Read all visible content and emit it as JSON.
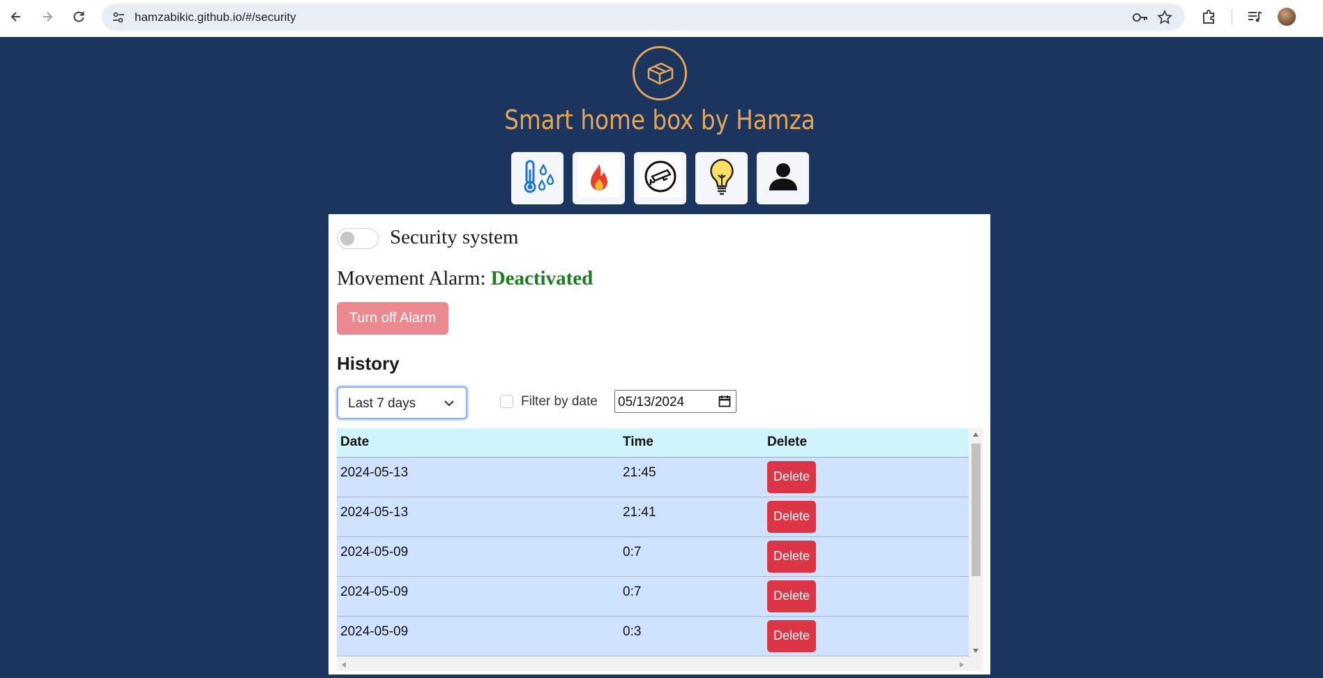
{
  "browser": {
    "url": "hamzabikic.github.io/#/security"
  },
  "header": {
    "title": "Smart home box by Hamza",
    "nav": [
      "temperature-humidity",
      "fire",
      "security-camera",
      "lighting",
      "user"
    ]
  },
  "security": {
    "toggle_label": "Security system",
    "toggle_on": false,
    "alarm_prefix": "Movement Alarm: ",
    "alarm_status": "Deactivated",
    "turn_off_label": "Turn off Alarm"
  },
  "history": {
    "title": "History",
    "range_value": "Last 7 days",
    "filter_label": "Filter by date",
    "filter_checked": false,
    "date_value": "05/13/2024",
    "columns": [
      "Date",
      "Time",
      "Delete"
    ],
    "rows": [
      {
        "date": "2024-05-13",
        "time": "21:45",
        "action": "Delete"
      },
      {
        "date": "2024-05-13",
        "time": "21:41",
        "action": "Delete"
      },
      {
        "date": "2024-05-09",
        "time": "0:7",
        "action": "Delete"
      },
      {
        "date": "2024-05-09",
        "time": "0:7",
        "action": "Delete"
      },
      {
        "date": "2024-05-09",
        "time": "0:3",
        "action": "Delete"
      }
    ]
  },
  "colors": {
    "page_bg": "#1c355e",
    "accent": "#e4a65a",
    "status_ok": "#1a7d1f",
    "danger": "#dc3545"
  }
}
